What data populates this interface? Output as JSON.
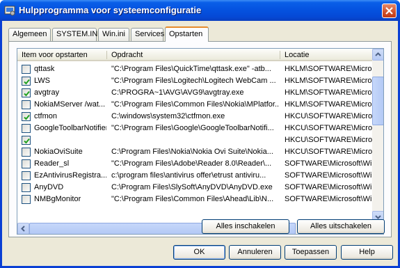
{
  "window": {
    "title": "Hulpprogramma voor systeemconfiguratie"
  },
  "tabs": [
    {
      "label": "Algemeen",
      "active": false
    },
    {
      "label": "SYSTEM.INI",
      "active": false
    },
    {
      "label": "Win.ini",
      "active": false
    },
    {
      "label": "Services",
      "active": false
    },
    {
      "label": "Opstarten",
      "active": true
    }
  ],
  "list": {
    "columns": [
      "Item voor opstarten",
      "Opdracht",
      "Locatie"
    ],
    "rows": [
      {
        "checked": false,
        "item": "qttask",
        "command": "\"C:\\Program Files\\QuickTime\\qttask.exe\" -atb...",
        "location": "HKLM\\SOFTWARE\\Microsof"
      },
      {
        "checked": true,
        "item": "LWS",
        "command": "\"C:\\Program Files\\Logitech\\Logitech WebCam ...",
        "location": "HKLM\\SOFTWARE\\Microsof"
      },
      {
        "checked": true,
        "item": "avgtray",
        "command": "C:\\PROGRA~1\\AVG\\AVG9\\avgtray.exe",
        "location": "HKLM\\SOFTWARE\\Microsof"
      },
      {
        "checked": false,
        "item": "NokiaMServer /wat...",
        "command": "\"C:\\Program Files\\Common Files\\Nokia\\MPlatfor...",
        "location": "HKLM\\SOFTWARE\\Microsof"
      },
      {
        "checked": true,
        "item": "ctfmon",
        "command": "C:\\windows\\system32\\ctfmon.exe",
        "location": "HKCU\\SOFTWARE\\Microsof"
      },
      {
        "checked": false,
        "item": "GoogleToolbarNotifier",
        "command": "\"C:\\Program Files\\Google\\GoogleToolbarNotifi...",
        "location": "HKCU\\SOFTWARE\\Microsof"
      },
      {
        "checked": true,
        "item": "",
        "command": "",
        "location": "HKCU\\SOFTWARE\\Microsof"
      },
      {
        "checked": false,
        "item": "NokiaOviSuite",
        "command": "C:\\Program Files\\Nokia\\Nokia Ovi Suite\\Nokia...",
        "location": "HKCU\\SOFTWARE\\Microsof"
      },
      {
        "checked": false,
        "item": "Reader_sl",
        "command": "\"C:\\Program Files\\Adobe\\Reader 8.0\\Reader\\...",
        "location": "SOFTWARE\\Microsoft\\Wind"
      },
      {
        "checked": false,
        "item": "EzAntivirusRegistra...",
        "command": "c:\\program files\\antivirus offer\\etrust antiviru...",
        "location": "SOFTWARE\\Microsoft\\Wind"
      },
      {
        "checked": false,
        "item": "AnyDVD",
        "command": "C:\\Program Files\\SlySoft\\AnyDVD\\AnyDVD.exe",
        "location": "SOFTWARE\\Microsoft\\Wind"
      },
      {
        "checked": false,
        "item": "NMBgMonitor",
        "command": "\"C:\\Program Files\\Common Files\\Ahead\\Lib\\N...",
        "location": "SOFTWARE\\Microsoft\\Wind"
      }
    ]
  },
  "actions": {
    "enable_all": "Alles inschakelen",
    "disable_all": "Alles uitschakelen"
  },
  "footer": {
    "ok": "OK",
    "cancel": "Annuleren",
    "apply": "Toepassen",
    "help": "Help"
  }
}
